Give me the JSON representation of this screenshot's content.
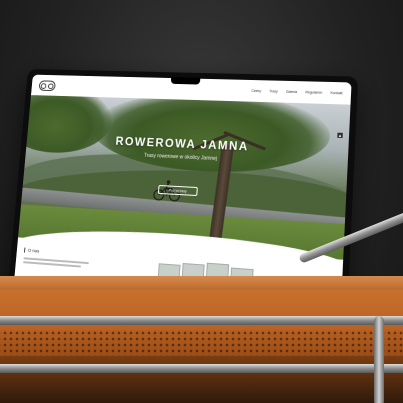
{
  "site": {
    "logo_icon": "bicycle-logo-icon",
    "nav": [
      "Cztery",
      "Trasy",
      "Galeria",
      "Regulamin",
      "Kontakt"
    ],
    "hero": {
      "title": "ROWEROWA JAMNA",
      "subtitle": "Trasy rowerowe w okolicy Jamnej",
      "cta": "Poznaj trasy",
      "arrow_icon": "chevron-up-icon"
    },
    "about": {
      "title": "O nas"
    }
  },
  "colors": {
    "accent": "#c8702d",
    "dark": "#151515",
    "hero_text": "#ffffff"
  }
}
